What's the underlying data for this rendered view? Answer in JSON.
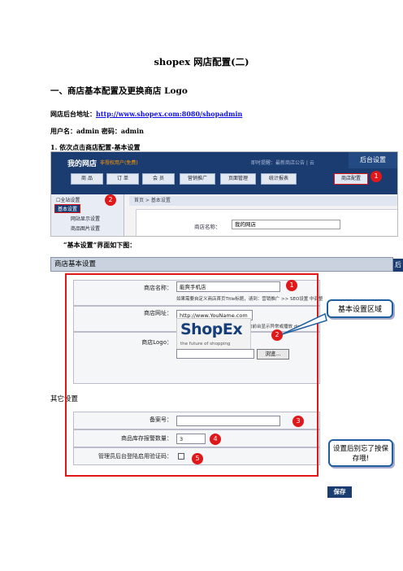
{
  "doc": {
    "title": "shopex 网店配置(二)",
    "heading": "一、商店基本配置及更换商店 Logo",
    "backend_label": "网店后台地址：",
    "backend_url": "http://www.shopex.com:8080/shopadmin",
    "credentials": "用户名：admin   密码：admin",
    "step1": "1. 依次点击商店配置-基本设置",
    "caption": "“基本设置”界面如下图："
  },
  "screenshot1": {
    "logo": "我的网店",
    "user": "非授权用户(免费)",
    "info": "即时提醒：最新商店公告 | 云",
    "admin_tab": "后台设置",
    "nav": [
      "商 品",
      "订 单",
      "会 员",
      "营销推广",
      "页面管理",
      "统计报表",
      "商店配置"
    ],
    "sidebar": [
      "全站设置",
      "基本设置",
      "网站显示设置",
      "商品图片设置"
    ],
    "breadcrumb": "首页 > 基本设置",
    "shop_name_label": "商店名称：",
    "shop_name_value": "我的网店",
    "markers": [
      "1",
      "2"
    ]
  },
  "screenshot2": {
    "header": "商店基本设置",
    "header_right": "后",
    "shop_name_label": "商店名称：",
    "shop_name_value": "能爽手机店",
    "shop_name_hint": "如果需要自定义商店首页Title标题，请到：营销推广 >> SEO设置 中调整",
    "shop_url_label": "商店网址：",
    "shop_url_value": "http://www.YouName.com",
    "shop_url_hint": "请正确填写您的商店网址，否则会导致前台显示异常或播放 dispu",
    "logo_label": "商店Logo：",
    "logo_main": "ShopEx",
    "logo_tagline": "the future of shopping",
    "browse_button": "浏览...",
    "other_section": "其它设置",
    "icp_label": "备案号：",
    "stock_label": "商品库存报警数量：",
    "stock_value": "3",
    "captcha_label": "管理员后台登陆启用验证码：",
    "save_button": "保存",
    "markers": [
      "1",
      "2",
      "3",
      "4",
      "5"
    ],
    "callout_basic": "基本设置区域",
    "callout_save": "设置后别忘了按保存哦!"
  }
}
